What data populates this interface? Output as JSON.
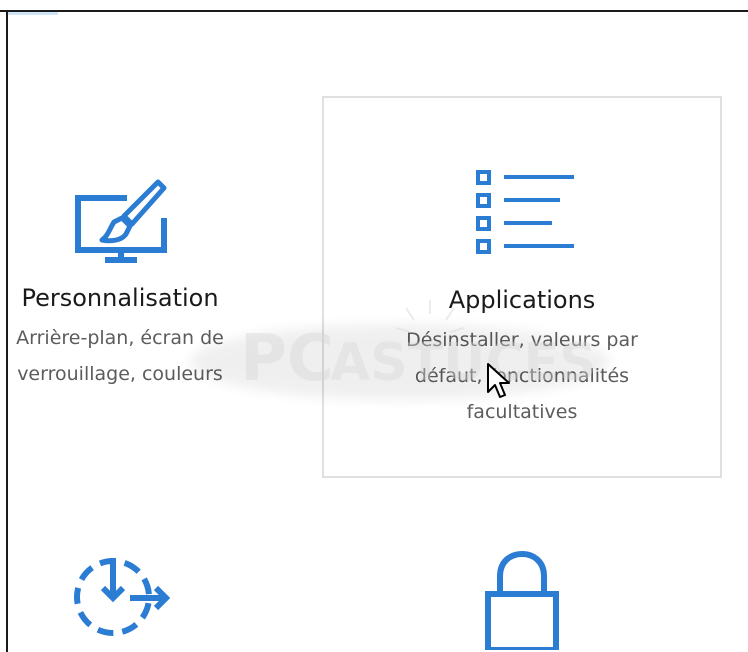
{
  "tiles": [
    {
      "id": "personnalisation",
      "icon": "monitor-brush-icon",
      "title": "Personnalisation",
      "desc": "Arrière-plan, écran de verrouillage, couleurs"
    },
    {
      "id": "applications",
      "icon": "app-list-icon",
      "title": "Applications",
      "desc": "Désinstaller, valeurs par défaut, fonctionnalités facultatives"
    },
    {
      "id": "update",
      "icon": "update-arrow-icon"
    },
    {
      "id": "security",
      "icon": "lock-icon"
    }
  ],
  "watermark": {
    "text": "PC Astuces"
  },
  "colors": {
    "accent": "#2b7cd3",
    "hover_border": "#e0e0e0",
    "title": "#1a1a1a",
    "desc": "#5c5c5c"
  }
}
